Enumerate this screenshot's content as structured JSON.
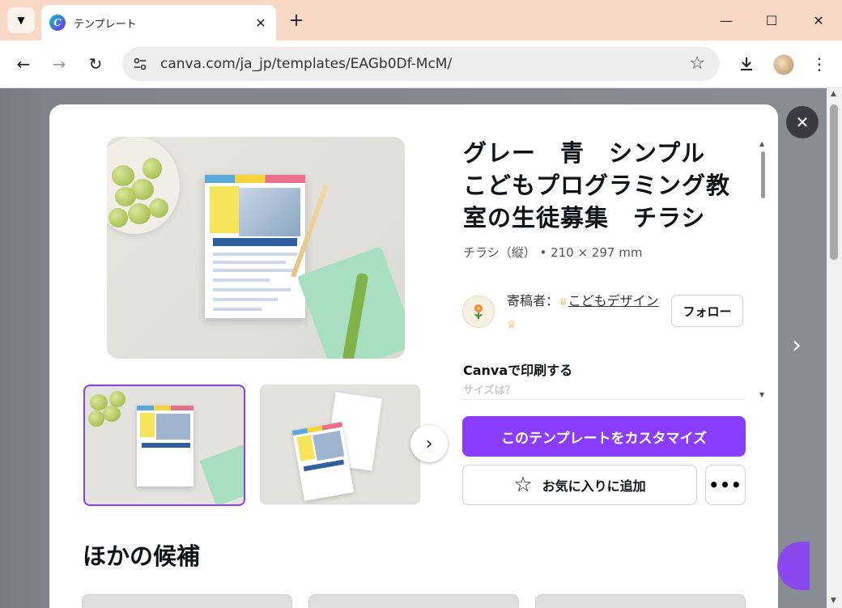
{
  "browser": {
    "tab_title": "テンプレート",
    "url": "canva.com/ja_jp/templates/EAGb0Df-McM/",
    "favicon_letter": "C"
  },
  "template": {
    "title": "グレー　青　シンプル　こどもプログラミング教室の生徒募集　チラシ",
    "subtitle": "チラシ（縦） • 210 × 297 mm",
    "creator_prefix": "寄稿者：",
    "creator_name": "こどもデザイン",
    "follow_label": "フォロー",
    "print_heading": "Canvaで印刷する",
    "print_sub": "サイズは？",
    "customize_label": "このテンプレートをカスタマイズ",
    "favorite_label": "お気に入りに追加",
    "more_label": "•••"
  },
  "section": {
    "others_title": "ほかの候補"
  },
  "colors": {
    "accent": "#8b3dff",
    "tabbar": "#f9d8c6"
  }
}
